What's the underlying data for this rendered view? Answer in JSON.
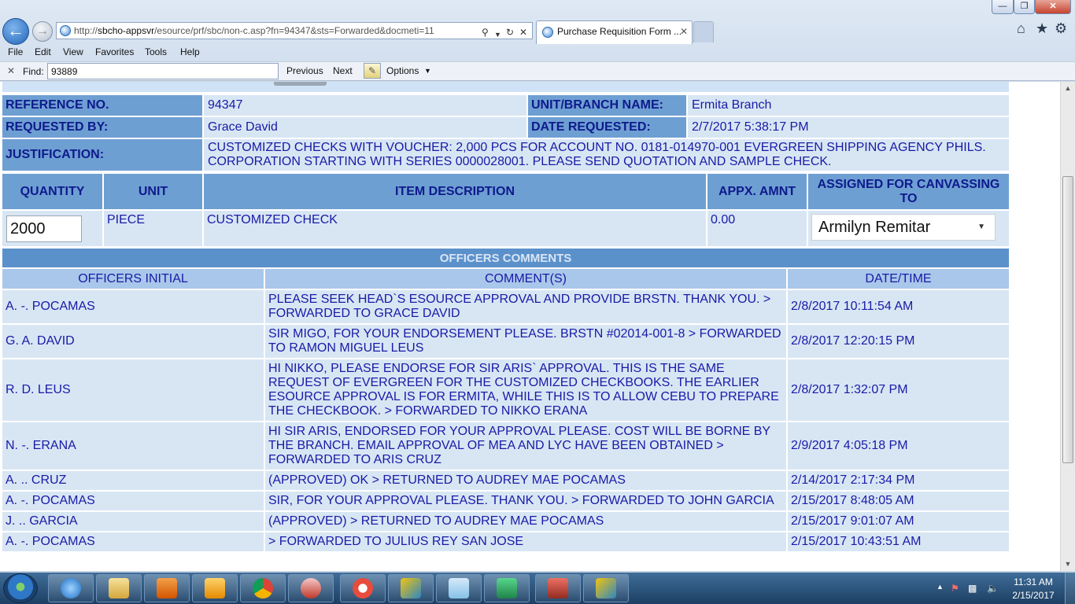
{
  "browser": {
    "address_prefix": "http://",
    "address_host": "sbcho-appsvr",
    "address_path": "/esource/prf/sbc/non-c.asp?fn=94347&sts=Forwarded&docmeti=11",
    "tab_title": "Purchase Requisition Form ...",
    "tab_close": "✕",
    "window_buttons": {
      "minimize": "—",
      "maximize": "❐",
      "close": "✕"
    },
    "menu": [
      "File",
      "Edit",
      "View",
      "Favorites",
      "Tools",
      "Help"
    ],
    "icons": {
      "home": "home-icon",
      "favorites": "star-icon",
      "tools": "gear-icon"
    }
  },
  "findbar": {
    "close": "✕",
    "label": "Find:",
    "value": "93889",
    "previous": "Previous",
    "next": "Next",
    "options": "Options"
  },
  "form": {
    "reference_label": "REFERENCE NO.",
    "reference_value": "94347",
    "unit_label": "UNIT/BRANCH NAME:",
    "unit_value": "Ermita Branch",
    "requested_by_label": "REQUESTED BY:",
    "requested_by_value": "Grace David",
    "date_requested_label": "DATE REQUESTED:",
    "date_requested_value": "2/7/2017 5:38:17 PM",
    "justification_label": "JUSTIFICATION:",
    "justification_value": "CUSTOMIZED CHECKS WITH VOUCHER: 2,000 PCS FOR ACCOUNT NO. 0181-014970-001 EVERGREEN SHIPPING AGENCY PHILS. CORPORATION STARTING WITH SERIES 0000028001. PLEASE SEND QUOTATION AND SAMPLE CHECK."
  },
  "items": {
    "headers": {
      "quantity": "QUANTITY",
      "unit": "UNIT",
      "description": "ITEM DESCRIPTION",
      "amount": "APPX. AMNT",
      "assigned": "ASSIGNED FOR CANVASSING TO"
    },
    "row": {
      "quantity": "2000",
      "unit": "PIECE",
      "description": "CUSTOMIZED CHECK",
      "amount": "0.00",
      "assigned": "Armilyn Remitar"
    }
  },
  "comments": {
    "title": "OFFICERS COMMENTS",
    "headers": {
      "initial": "OFFICERS INITIAL",
      "comment": "COMMENT(S)",
      "date": "DATE/TIME"
    },
    "rows": [
      {
        "initial": "A. -. POCAMAS",
        "comment": "PLEASE SEEK HEAD`S ESOURCE APPROVAL AND PROVIDE BRSTN. THANK YOU. > FORWARDED TO GRACE DAVID",
        "date": "2/8/2017 10:11:54 AM"
      },
      {
        "initial": "G. A. DAVID",
        "comment": "SIR MIGO, FOR YOUR ENDORSEMENT PLEASE. BRSTN #02014-001-8 > FORWARDED TO RAMON MIGUEL LEUS",
        "date": "2/8/2017 12:20:15 PM"
      },
      {
        "initial": "R. D. LEUS",
        "comment": "HI NIKKO, PLEASE ENDORSE FOR SIR ARIS` APPROVAL. THIS IS THE SAME REQUEST OF EVERGREEN FOR THE CUSTOMIZED CHECKBOOKS. THE EARLIER ESOURCE APPROVAL IS FOR ERMITA, WHILE THIS IS TO ALLOW CEBU TO PREPARE THE CHECKBOOK. > FORWARDED TO NIKKO ERANA",
        "date": "2/8/2017 1:32:07 PM"
      },
      {
        "initial": "N. -. ERANA",
        "comment": "HI SIR ARIS, ENDORSED FOR YOUR APPROVAL PLEASE. COST WILL BE BORNE BY THE BRANCH. EMAIL APPROVAL OF MEA AND LYC HAVE BEEN OBTAINED > FORWARDED TO ARIS CRUZ",
        "date": "2/9/2017 4:05:18 PM"
      },
      {
        "initial": "A. .. CRUZ",
        "comment": "(APPROVED) OK > RETURNED TO AUDREY MAE POCAMAS",
        "date": "2/14/2017 2:17:34 PM"
      },
      {
        "initial": "A. -. POCAMAS",
        "comment": "SIR, FOR YOUR APPROVAL PLEASE. THANK YOU. > FORWARDED TO JOHN GARCIA",
        "date": "2/15/2017 8:48:05 AM"
      },
      {
        "initial": "J. .. GARCIA",
        "comment": "(APPROVED) > RETURNED TO AUDREY MAE POCAMAS",
        "date": "2/15/2017 9:01:07 AM"
      },
      {
        "initial": "A. -. POCAMAS",
        "comment": "> FORWARDED TO JULIUS REY SAN JOSE",
        "date": "2/15/2017 10:43:51 AM"
      }
    ]
  },
  "taskbar": {
    "apps": [
      "internet-explorer-icon",
      "file-explorer-icon",
      "media-player-icon",
      "outlook-icon",
      "chrome-icon",
      "snipping-tool-icon",
      "app-icon",
      "dynamics-icon",
      "notepad-icon",
      "excel-icon",
      "pdf-icon",
      "dynamics-icon"
    ],
    "time": "11:31 AM",
    "date": "2/15/2017"
  },
  "colors": {
    "label_bg": "#6e9fd3",
    "value_bg": "#d8e6f4",
    "header_text": "#0e1a8c",
    "body_text": "#1a1aa6",
    "comments_title_bg": "#5b91cb",
    "comments_header_bg": "#a9c7ea"
  }
}
